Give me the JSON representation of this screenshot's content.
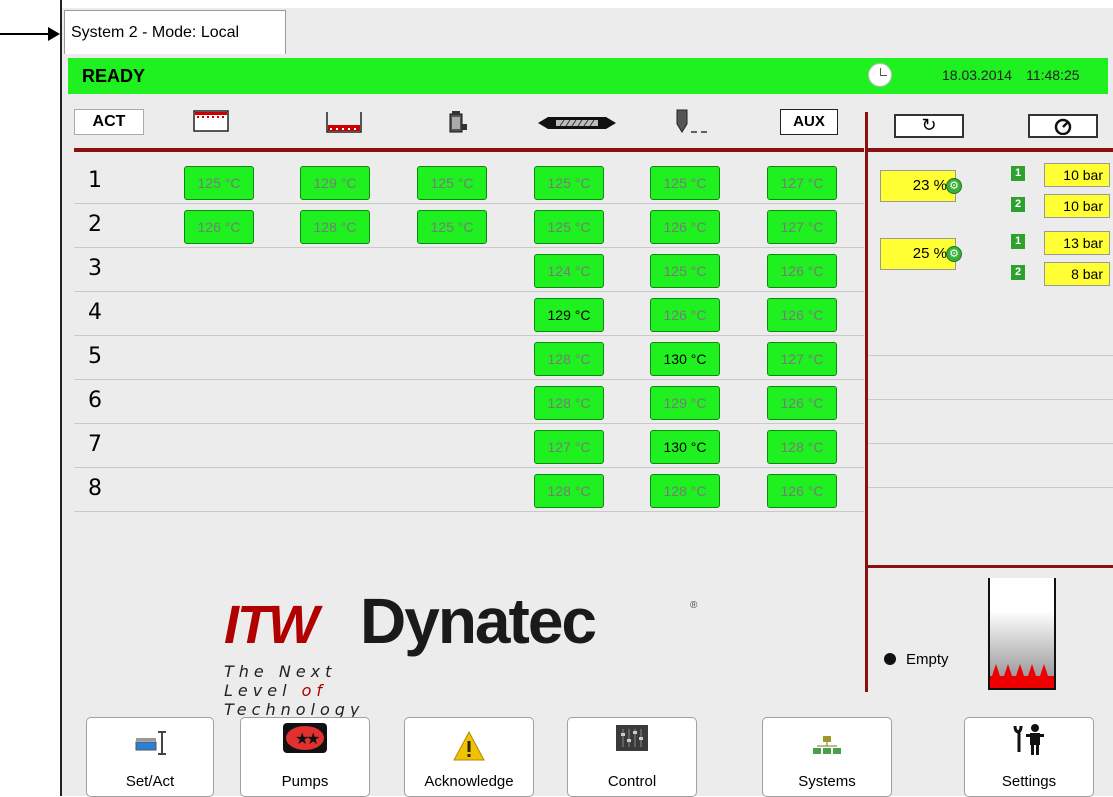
{
  "window": {
    "tab_title": "System 2 - Mode: Local"
  },
  "status": {
    "text": "READY",
    "date": "18.03.2014",
    "time": "11:48:25",
    "color": "#1ff01f"
  },
  "header": {
    "act_label": "ACT",
    "aux_label": "AUX",
    "icons": [
      "hopper-top-heat-icon",
      "hopper-bottom-heat-icon",
      "pump-filter-icon",
      "hose-icon",
      "applicator-head-icon"
    ],
    "right_icons": [
      "refresh-icon",
      "gauge-icon"
    ]
  },
  "rows": [
    {
      "num": "1",
      "cells": [
        "125 °C",
        "129 °C",
        "125 °C",
        "125 °C",
        "125 °C",
        "127 °C"
      ]
    },
    {
      "num": "2",
      "cells": [
        "126 °C",
        "128 °C",
        "125 °C",
        "125 °C",
        "126 °C",
        "127 °C"
      ]
    },
    {
      "num": "3",
      "cells": [
        "",
        "",
        "",
        "124 °C",
        "125 °C",
        "126 °C"
      ]
    },
    {
      "num": "4",
      "cells": [
        "",
        "",
        "",
        "129 °C",
        "126 °C",
        "126 °C"
      ]
    },
    {
      "num": "5",
      "cells": [
        "",
        "",
        "",
        "128 °C",
        "130 °C",
        "127 °C"
      ]
    },
    {
      "num": "6",
      "cells": [
        "",
        "",
        "",
        "128 °C",
        "129 °C",
        "126 °C"
      ]
    },
    {
      "num": "7",
      "cells": [
        "",
        "",
        "",
        "127 °C",
        "130 °C",
        "128 °C"
      ]
    },
    {
      "num": "8",
      "cells": [
        "",
        "",
        "",
        "128 °C",
        "128 °C",
        "126 °C"
      ]
    }
  ],
  "pumps": [
    {
      "percent": "23 %",
      "pressures": [
        {
          "n": "1",
          "value": "10 bar"
        },
        {
          "n": "2",
          "value": "10 bar"
        }
      ]
    },
    {
      "percent": "25 %",
      "pressures": [
        {
          "n": "1",
          "value": "13 bar"
        },
        {
          "n": "2",
          "value": "8 bar"
        }
      ]
    }
  ],
  "logo": {
    "brand_itw": "ITW",
    "brand_name": "Dynatec",
    "registered": "®",
    "tagline_a": "The Next Level ",
    "tagline_b": "of",
    "tagline_c": " Technology"
  },
  "tank": {
    "level_label": "Empty"
  },
  "footer": {
    "buttons": [
      {
        "label": "Set/Act",
        "icon": "set-act-icon"
      },
      {
        "label": "Pumps",
        "icon": "pumps-icon"
      },
      {
        "label": "Acknowledge",
        "icon": "warning-icon"
      },
      {
        "label": "Control",
        "icon": "control-icon"
      },
      {
        "label": "Systems",
        "icon": "systems-icon"
      },
      {
        "label": "Settings",
        "icon": "settings-icon"
      }
    ]
  }
}
